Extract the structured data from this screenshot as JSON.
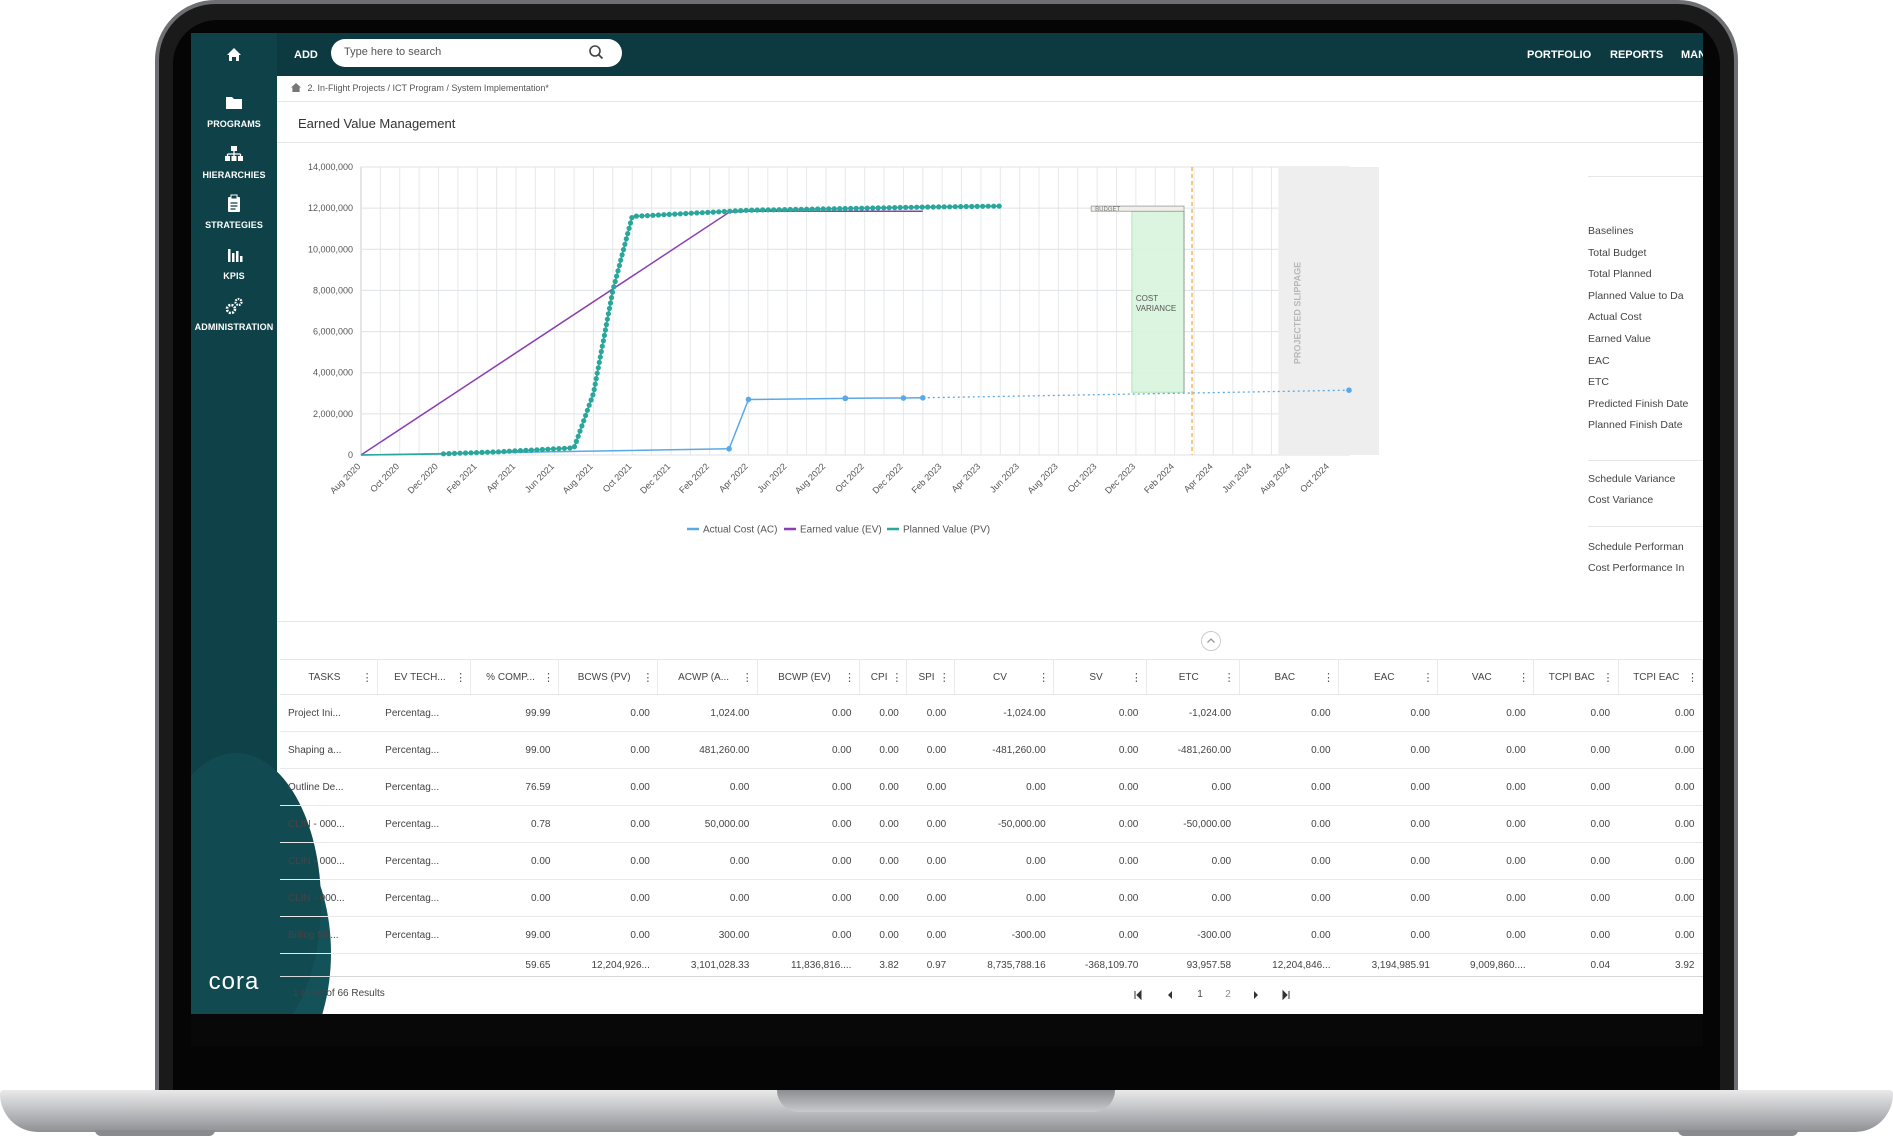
{
  "app": {
    "brand_logo": "cora",
    "nav_add": "ADD",
    "search_placeholder": "Type here to search",
    "nav_links": [
      "PORTFOLIO",
      "REPORTS",
      "MAN"
    ]
  },
  "sidebar": {
    "items": [
      {
        "label": "PROGRAMS",
        "icon": "folder-icon"
      },
      {
        "label": "HIERARCHIES",
        "icon": "hierarchy-icon"
      },
      {
        "label": "STRATEGIES",
        "icon": "clipboard-icon"
      },
      {
        "label": "KPIS",
        "icon": "bar-chart-icon"
      },
      {
        "label": "ADMINISTRATION",
        "icon": "gears-icon"
      }
    ]
  },
  "breadcrumb": "2. In-Flight Projects / ICT Program / System Implementation*",
  "page_title": "Earned Value Management",
  "chart_data": {
    "type": "line",
    "y_ticks": [
      "0",
      "2,000,000",
      "4,000,000",
      "6,000,000",
      "8,000,000",
      "10,000,000",
      "12,000,000",
      "14,000,000"
    ],
    "ylim": [
      0,
      14000000
    ],
    "x_ticks": [
      "Aug 2020",
      "Oct 2020",
      "Dec 2020",
      "Feb 2021",
      "Apr 2021",
      "Jun 2021",
      "Aug 2021",
      "Oct 2021",
      "Dec 2021",
      "Feb 2022",
      "Apr 2022",
      "Jun 2022",
      "Aug 2022",
      "Oct 2022",
      "Dec 2022",
      "Feb 2023",
      "Apr 2023",
      "Jun 2023",
      "Aug 2023",
      "Oct 2023",
      "Dec 2023",
      "Feb 2024",
      "Apr 2024",
      "Jun 2024",
      "Aug 2024",
      "Oct 2024"
    ],
    "legend": [
      "Actual Cost (AC)",
      "Earned value (EV)",
      "Planned Value (PV)"
    ],
    "series": [
      {
        "name": "Actual Cost (AC)",
        "color": "#5aa9e6",
        "points": [
          [
            "Aug 2020",
            0
          ],
          [
            "Mar 2022",
            300000
          ],
          [
            "Apr 2022",
            2700000
          ],
          [
            "Sep 2022",
            2750000
          ],
          [
            "Sep 2022",
            2760000
          ],
          [
            "Dec 2022",
            2770000
          ],
          [
            "Jan 2023",
            2780000
          ]
        ],
        "projection": [
          [
            "Jan 2023",
            2780000
          ],
          [
            "Nov 2024",
            3150000
          ]
        ]
      },
      {
        "name": "Earned value (EV)",
        "color": "#8a3fb5",
        "points": [
          [
            "Aug 2020",
            0
          ],
          [
            "Mar 2022",
            11800000
          ],
          [
            "Apr 2022",
            11850000
          ],
          [
            "Jan 2023",
            11850000
          ]
        ]
      },
      {
        "name": "Planned Value (PV)",
        "color": "#2aa79b",
        "points": [
          [
            "Aug 2020",
            0
          ],
          [
            "Dec 2020",
            50000
          ],
          [
            "Mar 2021",
            150000
          ],
          [
            "Jul 2021",
            350000
          ],
          [
            "Aug 2021",
            3000000
          ],
          [
            "Sep 2021",
            8000000
          ],
          [
            "Oct 2021",
            11600000
          ],
          [
            "Dec 2021",
            11700000
          ],
          [
            "Apr 2022",
            11900000
          ],
          [
            "Jan 2023",
            12050000
          ],
          [
            "May 2023",
            12100000
          ]
        ]
      }
    ],
    "annotations": {
      "cost_variance_label": [
        "COST",
        "VARIANCE"
      ],
      "projected_slippage_label": "PROJECTED SLIPPAGE",
      "budget_label": "BUDGET"
    }
  },
  "legend_panel": {
    "group1": [
      "Baselines",
      "Total Budget",
      "Total Planned",
      "Planned Value to Da",
      "Actual Cost",
      "Earned Value",
      "EAC",
      "ETC",
      "Predicted Finish Date",
      "Planned Finish Date"
    ],
    "group2": [
      "Schedule Variance",
      "Cost Variance"
    ],
    "group3": [
      "Schedule Performan",
      "Cost Performance In"
    ]
  },
  "table": {
    "headers": [
      "TASKS",
      "EV TECH...",
      "% COMP...",
      "BCWS (PV)",
      "ACWP (A...",
      "BCWP (EV)",
      "CPI",
      "SPI",
      "CV",
      "SV",
      "ETC",
      "BAC",
      "EAC",
      "VAC",
      "TCPI BAC",
      "TCPI EAC"
    ],
    "rows": [
      [
        "Project Ini...",
        "Percentag...",
        "99.99",
        "0.00",
        "1,024.00",
        "0.00",
        "0.00",
        "0.00",
        "-1,024.00",
        "0.00",
        "-1,024.00",
        "0.00",
        "0.00",
        "0.00",
        "0.00",
        "0.00"
      ],
      [
        "Shaping a...",
        "Percentag...",
        "99.00",
        "0.00",
        "481,260.00",
        "0.00",
        "0.00",
        "0.00",
        "-481,260.00",
        "0.00",
        "-481,260.00",
        "0.00",
        "0.00",
        "0.00",
        "0.00",
        "0.00"
      ],
      [
        "Outline De...",
        "Percentag...",
        "76.59",
        "0.00",
        "0.00",
        "0.00",
        "0.00",
        "0.00",
        "0.00",
        "0.00",
        "0.00",
        "0.00",
        "0.00",
        "0.00",
        "0.00",
        "0.00"
      ],
      [
        "CLIN - 000...",
        "Percentag...",
        "0.78",
        "0.00",
        "50,000.00",
        "0.00",
        "0.00",
        "0.00",
        "-50,000.00",
        "0.00",
        "-50,000.00",
        "0.00",
        "0.00",
        "0.00",
        "0.00",
        "0.00"
      ],
      [
        "CLIN - 000...",
        "Percentag...",
        "0.00",
        "0.00",
        "0.00",
        "0.00",
        "0.00",
        "0.00",
        "0.00",
        "0.00",
        "0.00",
        "0.00",
        "0.00",
        "0.00",
        "0.00",
        "0.00"
      ],
      [
        "CLIN - 000...",
        "Percentag...",
        "0.00",
        "0.00",
        "0.00",
        "0.00",
        "0.00",
        "0.00",
        "0.00",
        "0.00",
        "0.00",
        "0.00",
        "0.00",
        "0.00",
        "0.00",
        "0.00"
      ],
      [
        "Billing Mil...",
        "Percentag...",
        "99.00",
        "0.00",
        "300.00",
        "0.00",
        "0.00",
        "0.00",
        "-300.00",
        "0.00",
        "-300.00",
        "0.00",
        "0.00",
        "0.00",
        "0.00",
        "0.00"
      ]
    ],
    "totals": [
      "",
      "",
      "59.65",
      "12,204,926...",
      "3,101,028.33",
      "11,836,816....",
      "3.82",
      "0.97",
      "8,735,788.16",
      "-368,109.70",
      "93,957.58",
      "12,204,846...",
      "3,194,985.91",
      "9,009,860....",
      "0.04",
      "3.92"
    ]
  },
  "pagination": {
    "results_text": "1 to 50 of 66 Results",
    "pages": [
      "1",
      "2"
    ]
  }
}
